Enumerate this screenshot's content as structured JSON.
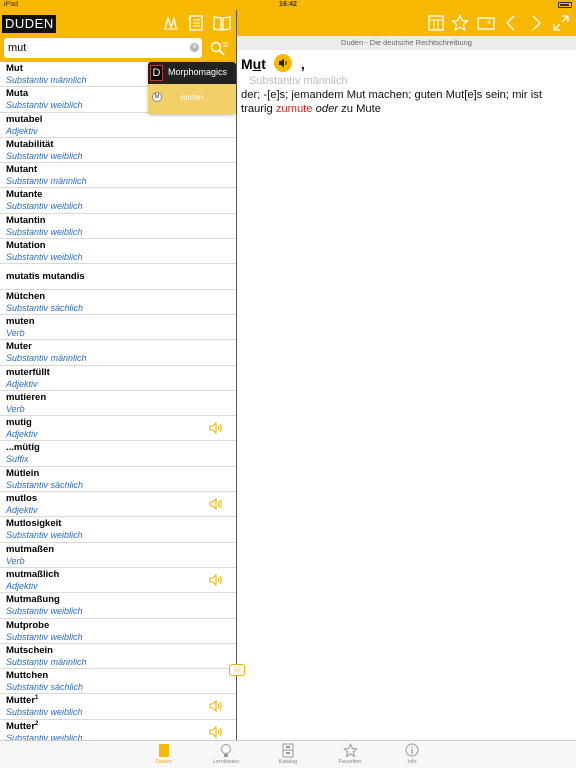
{
  "status": {
    "carrier": "iPad",
    "time": "16:42"
  },
  "left": {
    "logo": "DUDEN",
    "search": {
      "value": "mut"
    }
  },
  "results": [
    {
      "word": "Mut",
      "pos": "Substantiv männlich",
      "sound": false
    },
    {
      "word": "Muta",
      "pos": "Substantiv weiblich",
      "sound": false
    },
    {
      "word": "mutabel",
      "pos": "Adjektiv",
      "sound": false
    },
    {
      "word": "Mutabilität",
      "pos": "Substantiv weiblich",
      "sound": false
    },
    {
      "word": "Mutant",
      "pos": "Substantiv männlich",
      "sound": false
    },
    {
      "word": "Mutante",
      "pos": "Substantiv weiblich",
      "sound": false
    },
    {
      "word": "Mutantin",
      "pos": "Substantiv weiblich",
      "sound": false
    },
    {
      "word": "Mutation",
      "pos": "Substantiv weiblich",
      "sound": false
    },
    {
      "word": "mutatis mutandis",
      "pos": "",
      "sound": false
    },
    {
      "word": "Mütchen",
      "pos": "Substantiv sächlich",
      "sound": false
    },
    {
      "word": "muten",
      "pos": "Verb",
      "sound": false
    },
    {
      "word": "Muter",
      "pos": "Substantiv männlich",
      "sound": false
    },
    {
      "word": "muterfüllt",
      "pos": "Adjektiv",
      "sound": false
    },
    {
      "word": "mutieren",
      "pos": "Verb",
      "sound": false
    },
    {
      "word": "mutig",
      "pos": "Adjektiv",
      "sound": true
    },
    {
      "word": "...mütig",
      "pos": "Suffix",
      "sound": false
    },
    {
      "word": "Mütlein",
      "pos": "Substantiv sächlich",
      "sound": false
    },
    {
      "word": "mutlos",
      "pos": "Adjektiv",
      "sound": true
    },
    {
      "word": "Mutlosigkeit",
      "pos": "Substantiv weiblich",
      "sound": false
    },
    {
      "word": "mutmaßen",
      "pos": "Verb",
      "sound": false
    },
    {
      "word": "mutmaßlich",
      "pos": "Adjektiv",
      "sound": true
    },
    {
      "word": "Mutmaßung",
      "pos": "Substantiv weiblich",
      "sound": false
    },
    {
      "word": "Mutprobe",
      "pos": "Substantiv weiblich",
      "sound": false
    },
    {
      "word": "Mutschein",
      "pos": "Substantiv männlich",
      "sound": false
    },
    {
      "word": "Muttchen",
      "pos": "Substantiv sächlich",
      "sound": false
    },
    {
      "word": "Mutter",
      "sup": "1",
      "pos": "Substantiv weiblich",
      "sound": true
    },
    {
      "word": "Mutter",
      "sup": "2",
      "pos": "Substantiv weiblich",
      "sound": true
    }
  ],
  "popup": {
    "logo": "D",
    "title": "Morphomagics",
    "item_icon": "M",
    "item": "muten"
  },
  "drag_handle": "⟨|⟩",
  "right": {
    "source": "Duden - Die deutsche Rechtschreibung",
    "headword_pre": "M",
    "headword_und": "u",
    "headword_post": "t",
    "comma": ",",
    "grammar": "Substantiv männlich",
    "text_1": "der; -[e]s; jemandem Mut machen; guten Mut[e]s sein; mir ist traurig ",
    "text_red": "zumute",
    "text_sp1": " ",
    "text_it": "oder",
    "text_2": " zu Mute"
  },
  "tabs": [
    {
      "label": "Duden",
      "icon": "duden-book-icon"
    },
    {
      "label": "Lernkarten",
      "icon": "lightbulb-icon"
    },
    {
      "label": "Katalog",
      "icon": "catalog-icon"
    },
    {
      "label": "Favoriten",
      "icon": "star-icon"
    },
    {
      "label": "Info",
      "icon": "info-icon"
    }
  ],
  "colors": {
    "accent": "#f9b800",
    "pos_blue": "#2b6cc4",
    "link_red": "#e0251b"
  }
}
